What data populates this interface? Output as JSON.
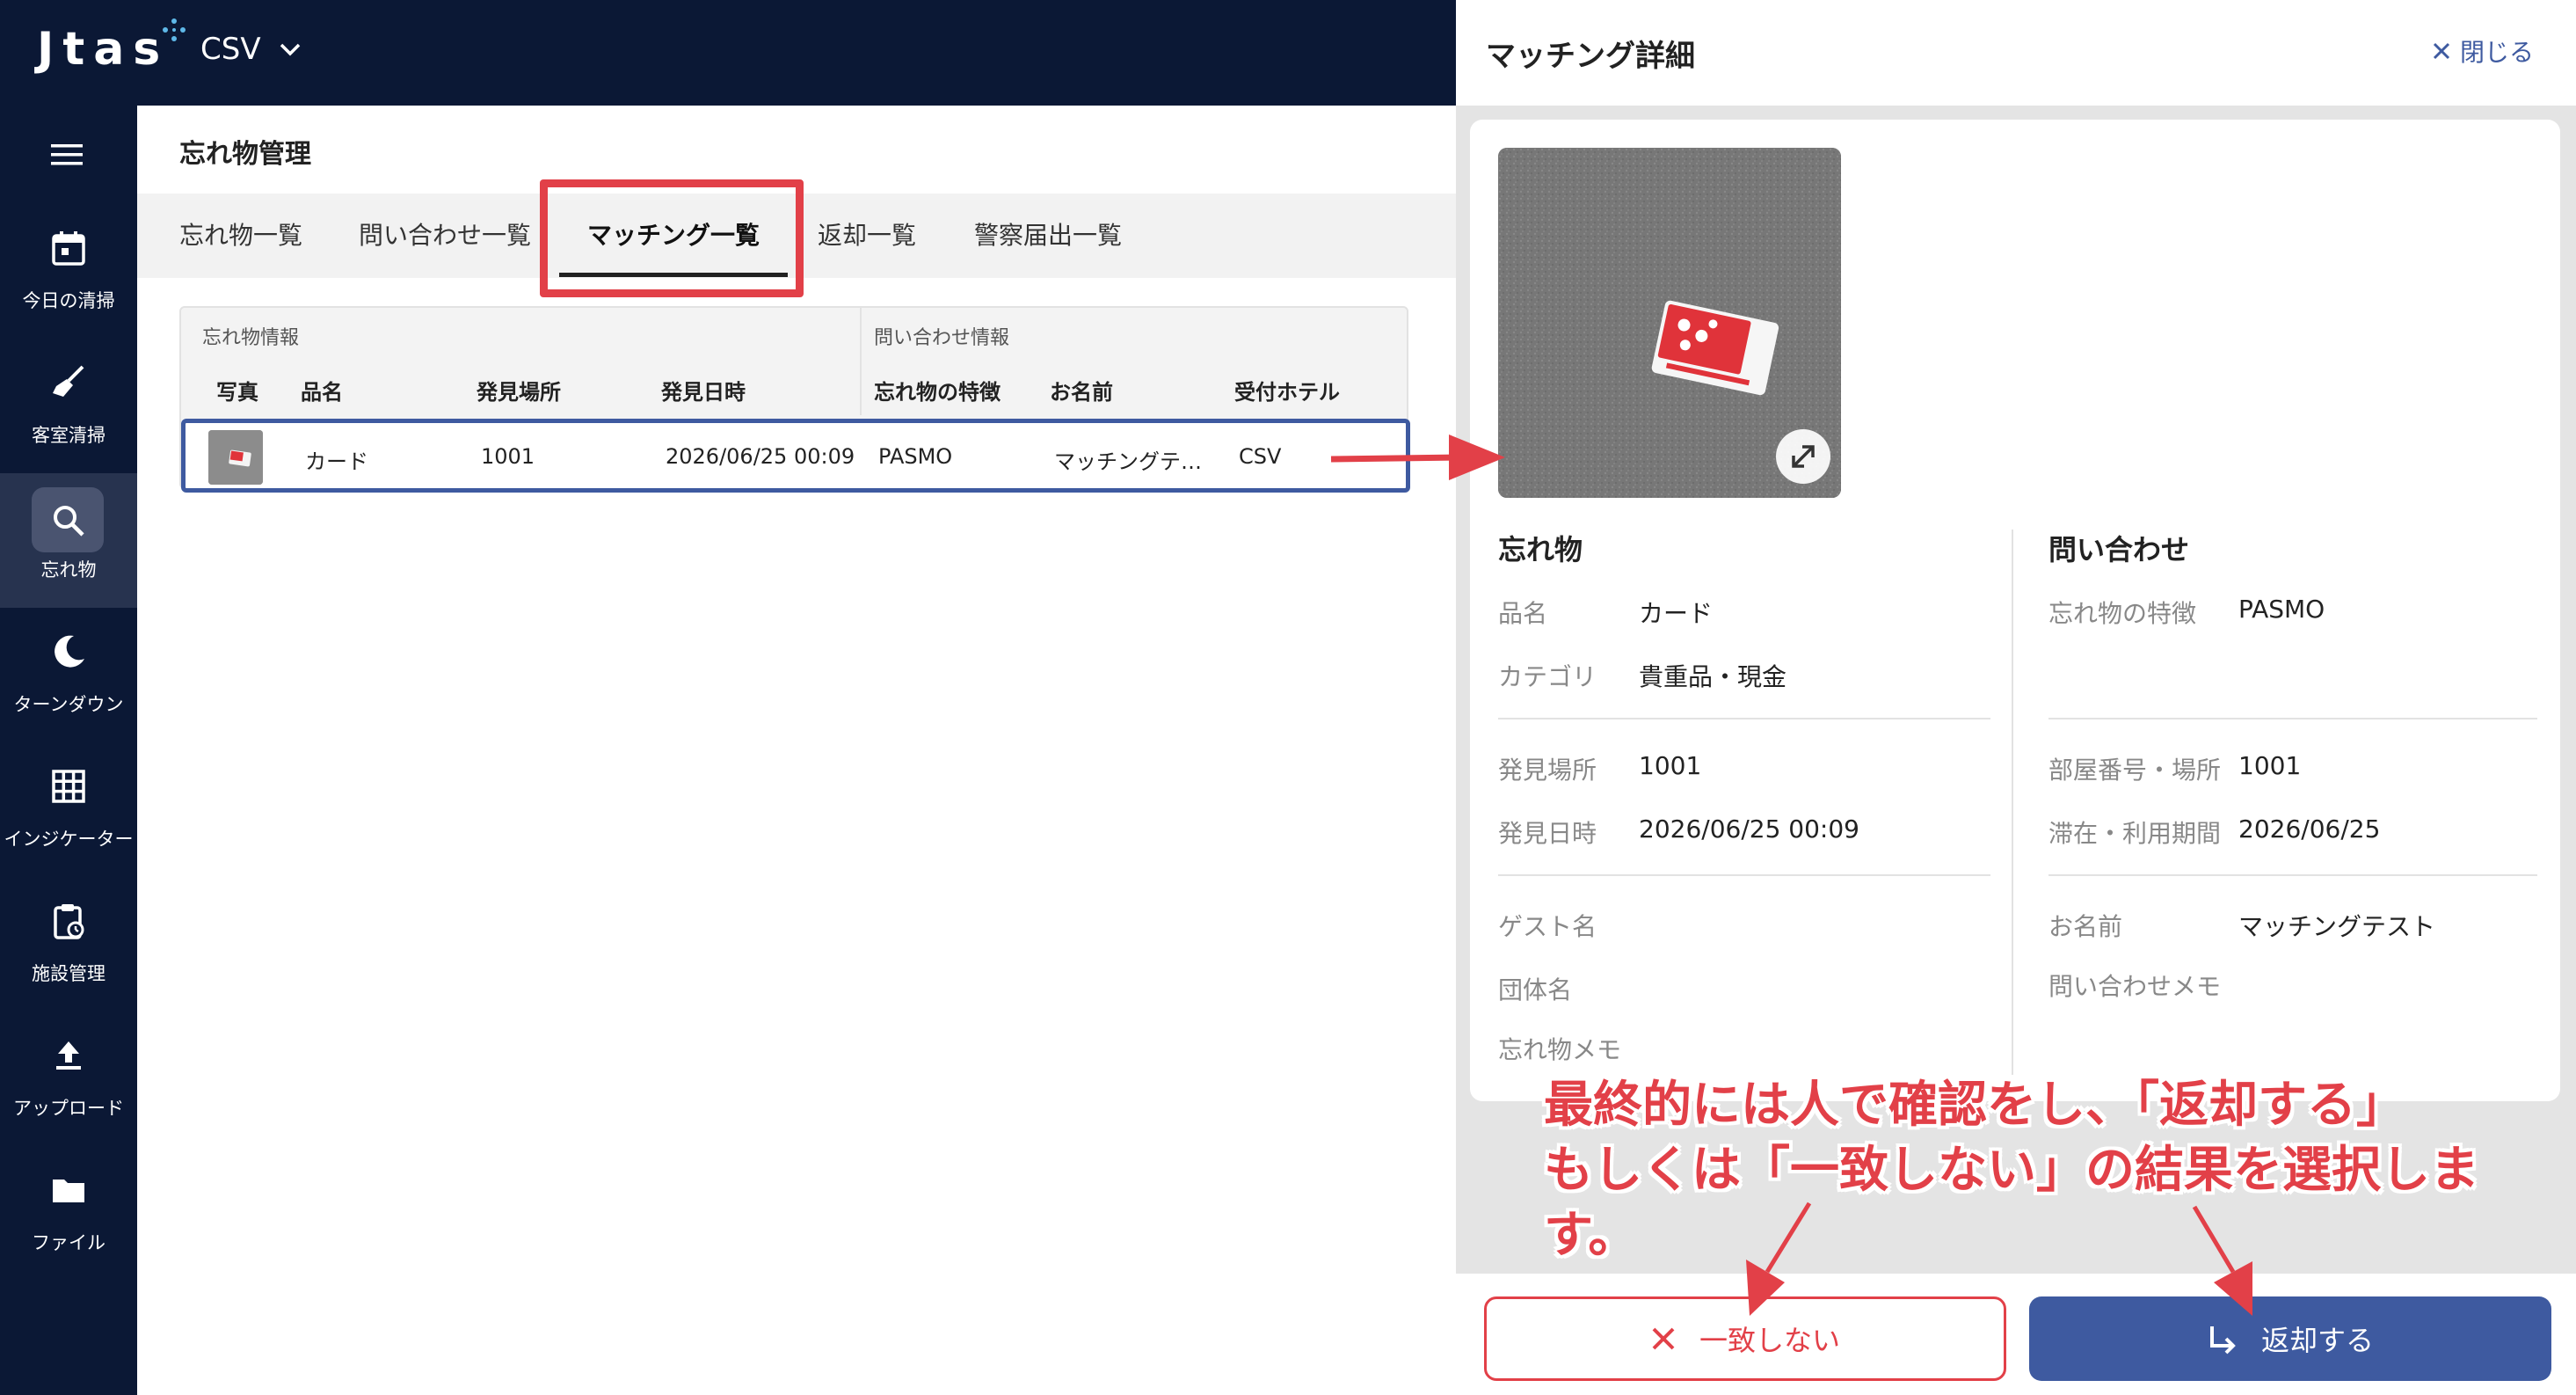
{
  "app": {
    "logo": "Jtas",
    "hotel_selector": "CSV"
  },
  "sidebar": {
    "items": [
      {
        "label": "今日の清掃"
      },
      {
        "label": "客室清掃"
      },
      {
        "label": "忘れ物"
      },
      {
        "label": "ターンダウン"
      },
      {
        "label": "インジケーター"
      },
      {
        "label": "施設管理"
      },
      {
        "label": "アップロード"
      },
      {
        "label": "ファイル"
      }
    ]
  },
  "main": {
    "page_title": "忘れ物管理",
    "tabs": [
      {
        "label": "忘れ物一覧"
      },
      {
        "label": "問い合わせ一覧"
      },
      {
        "label": "マッチング一覧"
      },
      {
        "label": "返却一覧"
      },
      {
        "label": "警察届出一覧"
      }
    ],
    "table": {
      "group_lost": "忘れ物情報",
      "group_inquiry": "問い合わせ情報",
      "headers": [
        "写真",
        "品名",
        "発見場所",
        "発見日時",
        "忘れ物の特徴",
        "お名前",
        "受付ホテル"
      ],
      "rows": [
        {
          "item_name": "カード",
          "found_place": "1001",
          "found_datetime": "2026/06/25 00:09",
          "feature": "PASMO",
          "name": "マッチングテ…",
          "hotel": "CSV"
        }
      ]
    }
  },
  "panel": {
    "title": "マッチング詳細",
    "close_label": "閉じる",
    "lost": {
      "section_title": "忘れ物",
      "item_name_label": "品名",
      "item_name": "カード",
      "category_label": "カテゴリ",
      "category": "貴重品・現金",
      "found_place_label": "発見場所",
      "found_place": "1001",
      "found_datetime_label": "発見日時",
      "found_datetime": "2026/06/25 00:09",
      "guest_label": "ゲスト名",
      "group_label": "団体名",
      "memo_label": "忘れ物メモ"
    },
    "inquiry": {
      "section_title": "問い合わせ",
      "feature_label": "忘れ物の特徴",
      "feature": "PASMO",
      "room_label": "部屋番号・場所",
      "room": "1001",
      "stay_label": "滞在・利用期間",
      "stay": "2026/06/25",
      "name_label": "お名前",
      "name": "マッチングテスト",
      "memo_label": "問い合わせメモ"
    },
    "reject_label": "一致しない",
    "return_label": "返却する"
  },
  "annotation": {
    "line1": "最終的には人で確認をし、「返却する」",
    "line2": "もしくは「一致しない」の結果を選択します。"
  },
  "colors": {
    "navy": "#0b1835",
    "accent_blue": "#3e5aa0",
    "callout_red": "#e24048"
  }
}
